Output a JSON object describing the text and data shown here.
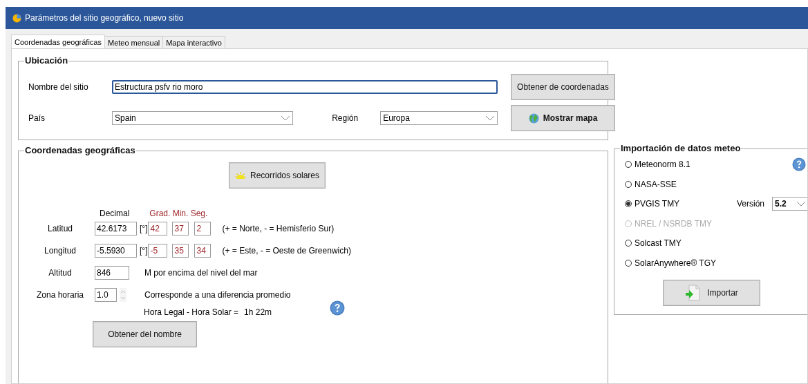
{
  "window": {
    "title": "Parámetros del sitio geográfico, nuevo sitio"
  },
  "tabs": [
    {
      "label": "Coordenadas geográficas",
      "selected": true
    },
    {
      "label": "Meteo mensual",
      "selected": false
    },
    {
      "label": "Mapa interactivo",
      "selected": false
    }
  ],
  "location": {
    "title": "Ubicación",
    "site_name": {
      "label": "Nombre del sitio",
      "value": "Estructura psfv rio moro"
    },
    "country": {
      "label": "País",
      "value": "Spain"
    },
    "region": {
      "label": "Región",
      "value": "Europa"
    },
    "coordinates_button": "Obtener de coordenadas",
    "map_button": "Mostrar mapa"
  },
  "coordinates": {
    "title": "Coordenadas geográficas",
    "solar_paths_button": "Recorridos solares",
    "decimal_header": "Decimal",
    "dms_header": "Grad. Min. Seg.",
    "rows": [
      {
        "label": "Latitud",
        "decimal": "42.6173",
        "unit": "[°]",
        "deg": "42",
        "min": "37",
        "sec": "2",
        "note": "(+ = Norte, - = Hemisferio Sur)"
      },
      {
        "label": "Longitud",
        "decimal": "-5.5930",
        "unit": "[°]",
        "deg": "-5",
        "min": "35",
        "sec": "34",
        "note": "(+ = Este, - = Oeste de Greenwich)"
      }
    ],
    "altitude": {
      "label": "Altitud",
      "value": "846",
      "note": "M por encima del nivel del mar"
    },
    "timezone": {
      "label": "Zona horaria",
      "value": "1.0",
      "note": "Corresponde a una diferencia promedio"
    },
    "difference": {
      "label": "Hora Legal - Hora Solar =",
      "value": "1h 22m"
    },
    "name_button": "Obtener del nombre"
  },
  "meteo_import": {
    "title": "Importación de datos meteo",
    "sources": [
      {
        "label": "Meteonorm 8.1",
        "selected": false,
        "disabled": false
      },
      {
        "label": "NASA-SSE",
        "selected": false,
        "disabled": false
      },
      {
        "label": "PVGIS TMY",
        "selected": true,
        "disabled": false,
        "version": {
          "label": "Versión",
          "value": "5.2"
        }
      },
      {
        "label": "NREL / NSRDB TMY",
        "selected": false,
        "disabled": true
      },
      {
        "label": "Solcast TMY",
        "selected": false,
        "disabled": false
      },
      {
        "label": "SolarAnywhere® TGY",
        "selected": false,
        "disabled": false
      }
    ],
    "import_button": "Importar"
  }
}
